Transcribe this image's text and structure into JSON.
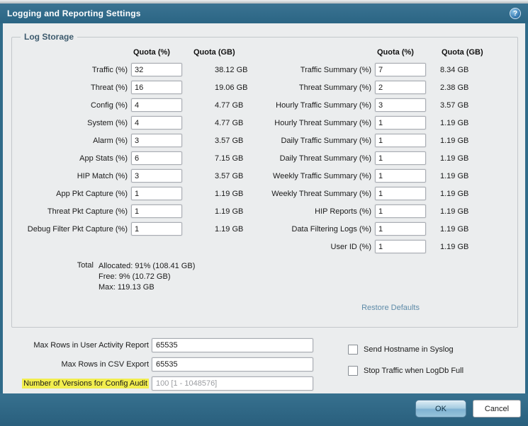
{
  "dialog": {
    "title": "Logging and Reporting Settings",
    "help_glyph": "?"
  },
  "colors": {
    "frame_teal": "#2f6b89",
    "highlight_yellow": "#f2ee4e",
    "link_blue": "#5e8ba8",
    "content_bg": "#ebedee"
  },
  "log_storage": {
    "legend": "Log Storage",
    "col_headers": {
      "pct": "Quota (%)",
      "gb": "Quota (GB)"
    },
    "left_rows": [
      {
        "label": "Traffic (%)",
        "value": "32",
        "gb": "38.12 GB"
      },
      {
        "label": "Threat (%)",
        "value": "16",
        "gb": "19.06 GB"
      },
      {
        "label": "Config (%)",
        "value": "4",
        "gb": "4.77 GB"
      },
      {
        "label": "System (%)",
        "value": "4",
        "gb": "4.77 GB"
      },
      {
        "label": "Alarm (%)",
        "value": "3",
        "gb": "3.57 GB"
      },
      {
        "label": "App Stats (%)",
        "value": "6",
        "gb": "7.15 GB"
      },
      {
        "label": "HIP Match (%)",
        "value": "3",
        "gb": "3.57 GB"
      },
      {
        "label": "App Pkt Capture (%)",
        "value": "1",
        "gb": "1.19 GB"
      },
      {
        "label": "Threat Pkt Capture (%)",
        "value": "1",
        "gb": "1.19 GB"
      },
      {
        "label": "Debug Filter Pkt Capture (%)",
        "value": "1",
        "gb": "1.19 GB"
      }
    ],
    "right_rows": [
      {
        "label": "Traffic Summary (%)",
        "value": "7",
        "gb": "8.34 GB"
      },
      {
        "label": "Threat Summary (%)",
        "value": "2",
        "gb": "2.38 GB"
      },
      {
        "label": "Hourly Traffic Summary (%)",
        "value": "3",
        "gb": "3.57 GB"
      },
      {
        "label": "Hourly Threat Summary (%)",
        "value": "1",
        "gb": "1.19 GB"
      },
      {
        "label": "Daily Traffic Summary (%)",
        "value": "1",
        "gb": "1.19 GB"
      },
      {
        "label": "Daily Threat Summary (%)",
        "value": "1",
        "gb": "1.19 GB"
      },
      {
        "label": "Weekly Traffic Summary (%)",
        "value": "1",
        "gb": "1.19 GB"
      },
      {
        "label": "Weekly Threat Summary (%)",
        "value": "1",
        "gb": "1.19 GB"
      },
      {
        "label": "HIP Reports (%)",
        "value": "1",
        "gb": "1.19 GB"
      },
      {
        "label": "Data Filtering Logs (%)",
        "value": "1",
        "gb": "1.19 GB"
      },
      {
        "label": "User ID (%)",
        "value": "1",
        "gb": "1.19 GB"
      }
    ],
    "total": {
      "label": "Total",
      "allocated": "Allocated: 91% (108.41 GB)",
      "free": "Free: 9% (10.72 GB)",
      "max": "Max: 119.13 GB"
    },
    "restore_defaults_label": "Restore Defaults"
  },
  "bottom": {
    "fields": [
      {
        "label": "Max Rows in User Activity Report",
        "value": "65535"
      },
      {
        "label": "Max Rows in CSV Export",
        "value": "65535"
      },
      {
        "label": "Number of Versions for Config Audit",
        "placeholder": "100 [1 - 1048576]",
        "highlighted": true
      }
    ],
    "checkboxes": [
      {
        "label": "Send Hostname in Syslog",
        "checked": false
      },
      {
        "label": "Stop Traffic when LogDb Full",
        "checked": false
      }
    ]
  },
  "footer": {
    "ok_label": "OK",
    "cancel_label": "Cancel"
  }
}
